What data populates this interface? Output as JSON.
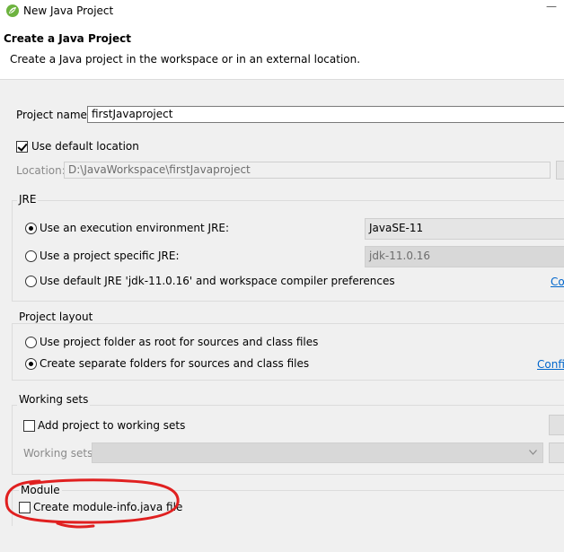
{
  "window": {
    "title": "New Java Project"
  },
  "header": {
    "title": "Create a Java Project",
    "description": "Create a Java project in the workspace or in an external location."
  },
  "project": {
    "name_label": "Project name:",
    "name_value": "firstJavaproject",
    "use_default_location_label": "Use default location",
    "use_default_location_checked": true,
    "location_label": "Location:",
    "location_value": "D:\\JavaWorkspace\\firstJavaproject"
  },
  "jre": {
    "title": "JRE",
    "option_exec_env_label": "Use an execution environment JRE:",
    "option_exec_env_value": "JavaSE-11",
    "option_project_specific_label": "Use a project specific JRE:",
    "option_project_specific_value": "jdk-11.0.16",
    "option_default_label": "Use default JRE 'jdk-11.0.16' and workspace compiler preferences",
    "configure_link": "Co",
    "selected": "exec_env"
  },
  "project_layout": {
    "title": "Project layout",
    "option_root_label": "Use project folder as root for sources and class files",
    "option_separate_label": "Create separate folders for sources and class files",
    "configure_link": "Confi",
    "selected": "separate"
  },
  "working_sets": {
    "title": "Working sets",
    "add_label": "Add project to working sets",
    "add_checked": false,
    "sets_label": "Working sets:"
  },
  "module": {
    "title": "Module",
    "create_label": "Create module-info.java file",
    "create_checked": false
  },
  "colors": {
    "annotation_circle": "#e02020",
    "link": "#0066cc"
  }
}
